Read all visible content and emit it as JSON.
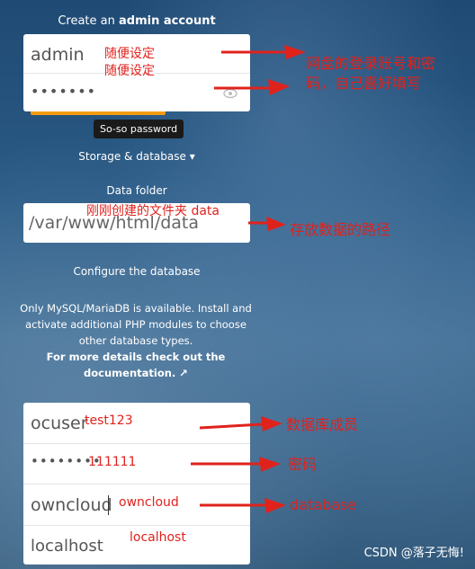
{
  "header": {
    "title_prefix": "Create an ",
    "title_bold": "admin account"
  },
  "admin": {
    "username": "admin",
    "password_mask": "•••••••",
    "strength_tooltip": "So-so password"
  },
  "storage_toggle": {
    "label": "Storage & database",
    "caret": "▾"
  },
  "data_folder": {
    "label": "Data folder",
    "value": "/var/www/html/data"
  },
  "database": {
    "label": "Configure the database",
    "info": [
      "Only MySQL/MariaDB is available. Install and",
      "activate additional PHP modules to choose",
      "other database types."
    ],
    "doc_link": [
      "For more details check out the",
      "documentation. ↗"
    ],
    "user": "ocuser",
    "password_mask": "••••••••",
    "name": "owncloud",
    "host": "localhost"
  },
  "annotations": {
    "admin_hint1": "随便设定",
    "admin_hint2": "随便设定",
    "login_note_line1": "网盘的登录账号和密",
    "login_note_line2": "码，自己喜好填写",
    "folder_hint": "刚刚创建的文件夹 data",
    "folder_note": "存放数据的路径",
    "db_user_value": "test123",
    "db_user_note": "数据库成员",
    "db_pass_value": "111111",
    "db_pass_note": "密码",
    "db_name_value": "owncloud",
    "db_name_note": "database",
    "db_host_value": "localhost"
  },
  "watermark": "CSDN @落子无悔!",
  "colors": {
    "annotation": "#e0221d",
    "strength_bar": "#f39c12"
  }
}
